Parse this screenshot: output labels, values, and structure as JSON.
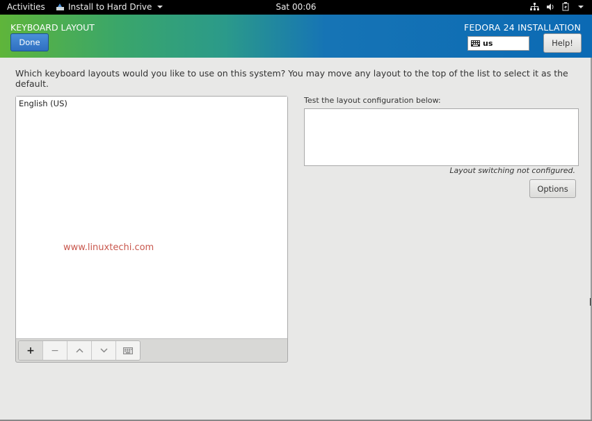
{
  "topbar": {
    "activities": "Activities",
    "app_name": "Install to Hard Drive",
    "clock": "Sat 00:06",
    "tray_icons": [
      "network-icon",
      "volume-icon",
      "battery-icon",
      "system-menu-caret"
    ]
  },
  "header": {
    "section_title": "KEYBOARD LAYOUT",
    "done_label": "Done",
    "product_title": "FEDORA 24 INSTALLATION",
    "keyboard_indicator": "us",
    "help_label": "Help!"
  },
  "main": {
    "question": "Which keyboard layouts would you like to use on this system?  You may move any layout to the top of the list to select it as the default.",
    "layouts": [
      {
        "label": "English (US)"
      }
    ],
    "watermark": "www.linuxtechi.com",
    "toolbar": [
      {
        "name": "add-layout-button",
        "glyph": "+"
      },
      {
        "name": "remove-layout-button",
        "glyph": "−"
      },
      {
        "name": "move-up-button",
        "glyph": "⌃"
      },
      {
        "name": "move-down-button",
        "glyph": "⌄"
      },
      {
        "name": "preview-layout-button",
        "glyph": "keyboard"
      }
    ],
    "test_label": "Test the layout configuration below:",
    "test_value": "",
    "switch_note": "Layout switching not configured.",
    "options_label": "Options"
  },
  "colors": {
    "done_button": "#2f6fc0",
    "header_left": "#5fb53a",
    "header_right": "#0b6ab4",
    "watermark": "#c8564c"
  }
}
